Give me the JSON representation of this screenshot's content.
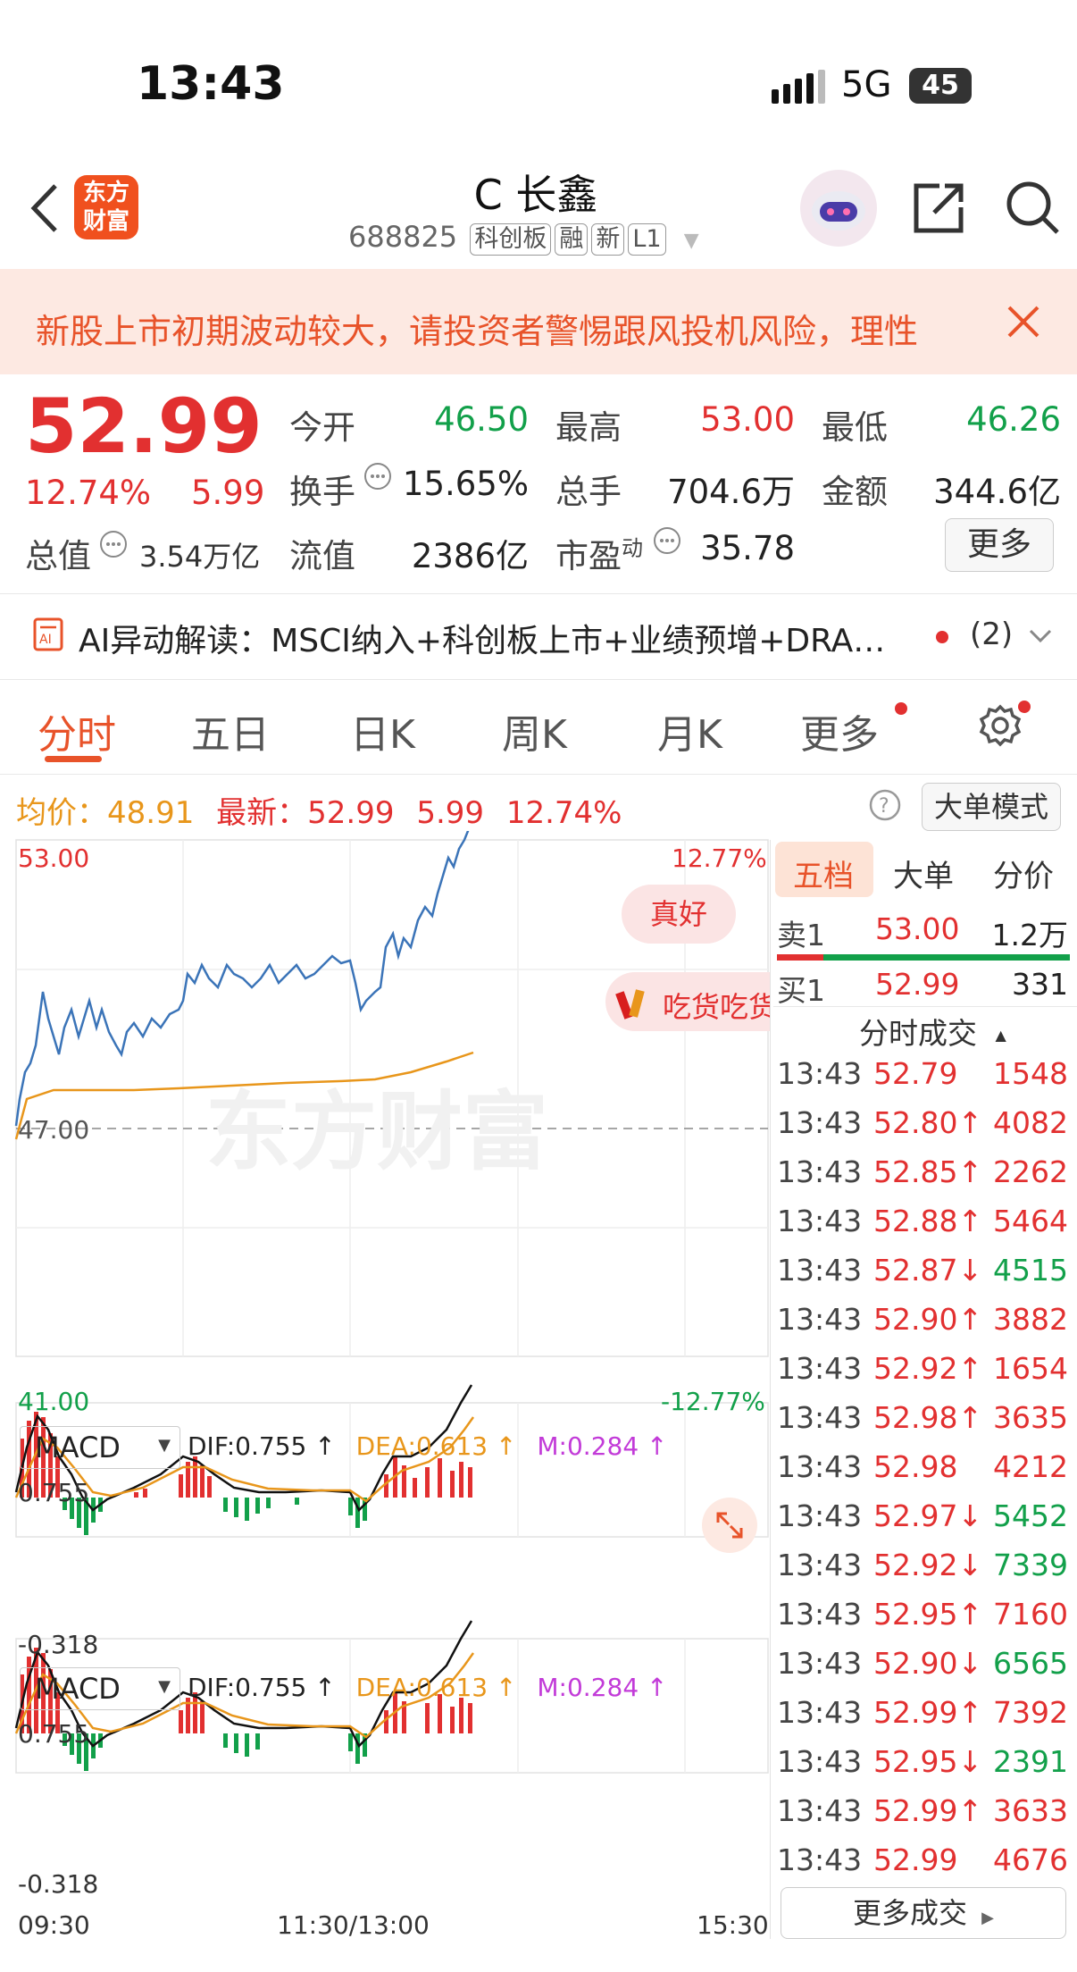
{
  "status_bar": {
    "time": "13:43",
    "network": "5G",
    "battery": "45"
  },
  "header": {
    "logo_text": "东方财富",
    "stock_name": "C 长鑫",
    "stock_code": "688825",
    "tags": [
      "科创板",
      "融",
      "新",
      "L1"
    ]
  },
  "notice": {
    "text": "新股上市初期波动较大，请投资者警惕跟风投机风险，理性"
  },
  "quote": {
    "price": "52.99",
    "change_pct": "12.74%",
    "change": "5.99",
    "open_label": "今开",
    "open": "46.50",
    "high_label": "最高",
    "high": "53.00",
    "low_label": "最低",
    "low": "46.26",
    "turnover_label": "换手",
    "turnover": "15.65%",
    "volume_label": "总手",
    "volume": "704.6万",
    "amount_label": "金额",
    "amount": "344.6亿",
    "mcap_label": "总值",
    "mcap": "3.54万亿",
    "float_label": "流值",
    "float": "2386亿",
    "pe_label": "市盈",
    "pe_sup": "动",
    "pe": "35.78",
    "more_button": "更多"
  },
  "ai_bar": {
    "text": "AI异动解读：MSCI纳入+科创板上市+业绩预增+DRA…",
    "count": "(2)"
  },
  "tabs": [
    "分时",
    "五日",
    "日K",
    "周K",
    "月K",
    "更多"
  ],
  "avg_line": {
    "avg_label": "均价：",
    "avg": "48.91",
    "latest_label": "最新：",
    "latest": "52.99",
    "change": "5.99",
    "pct": "12.74%",
    "mode_button": "大单模式"
  },
  "chart_labels": {
    "y_top": "53.00",
    "y_mid": "47.00",
    "y_bottom": "41.00",
    "pct_top": "12.77%",
    "pct_bottom": "-12.77%",
    "x_start": "09:30",
    "x_mid": "11:30/13:00",
    "x_end": "15:30",
    "bubble1": "真好",
    "bubble2": "吃货吃货",
    "watermark": "东方财富"
  },
  "macd_panels": [
    {
      "name": "MACD",
      "dif": "DIF:0.755 ↑",
      "dea": "DEA:0.613 ↑",
      "m": "M:0.284 ↑",
      "y_top": "0.755",
      "y_bottom": "-0.318"
    },
    {
      "name": "MACD",
      "dif": "DIF:0.755 ↑",
      "dea": "DEA:0.613 ↑",
      "m": "M:0.284 ↑",
      "y_top": "0.755",
      "y_bottom": "-0.318"
    }
  ],
  "sidebar": {
    "tabs": [
      "五档",
      "大单",
      "分价"
    ],
    "sell1": {
      "label": "卖1",
      "price": "53.00",
      "vol": "1.2万"
    },
    "buy1": {
      "label": "买1",
      "price": "52.99",
      "vol": "331"
    },
    "ticks_header": "分时成交",
    "ticks": [
      {
        "time": "13:43",
        "price": "52.79",
        "vol": "1548",
        "dir": ""
      },
      {
        "time": "13:43",
        "price": "52.80↑",
        "vol": "4082",
        "dir": "up"
      },
      {
        "time": "13:43",
        "price": "52.85↑",
        "vol": "2262",
        "dir": "up"
      },
      {
        "time": "13:43",
        "price": "52.88↑",
        "vol": "5464",
        "dir": "up"
      },
      {
        "time": "13:43",
        "price": "52.87↓",
        "vol": "4515",
        "dir": "down"
      },
      {
        "time": "13:43",
        "price": "52.90↑",
        "vol": "3882",
        "dir": "up"
      },
      {
        "time": "13:43",
        "price": "52.92↑",
        "vol": "1654",
        "dir": "up"
      },
      {
        "time": "13:43",
        "price": "52.98↑",
        "vol": "3635",
        "dir": "up"
      },
      {
        "time": "13:43",
        "price": "52.98",
        "vol": "4212",
        "dir": ""
      },
      {
        "time": "13:43",
        "price": "52.97↓",
        "vol": "5452",
        "dir": "down"
      },
      {
        "time": "13:43",
        "price": "52.92↓",
        "vol": "7339",
        "dir": "down"
      },
      {
        "time": "13:43",
        "price": "52.95↑",
        "vol": "7160",
        "dir": "up"
      },
      {
        "time": "13:43",
        "price": "52.90↓",
        "vol": "6565",
        "dir": "down"
      },
      {
        "time": "13:43",
        "price": "52.99↑",
        "vol": "7392",
        "dir": "up"
      },
      {
        "time": "13:43",
        "price": "52.95↓",
        "vol": "2391",
        "dir": "down"
      },
      {
        "time": "13:43",
        "price": "52.99↑",
        "vol": "3633",
        "dir": "up"
      },
      {
        "time": "13:43",
        "price": "52.99",
        "vol": "4676",
        "dir": ""
      }
    ],
    "more_trades": "更多成交"
  },
  "colors": {
    "up": "#e23030",
    "down": "#12a04a",
    "avg": "#e8961b",
    "price_line": "#3b74b8",
    "accent": "#f0501e"
  }
}
